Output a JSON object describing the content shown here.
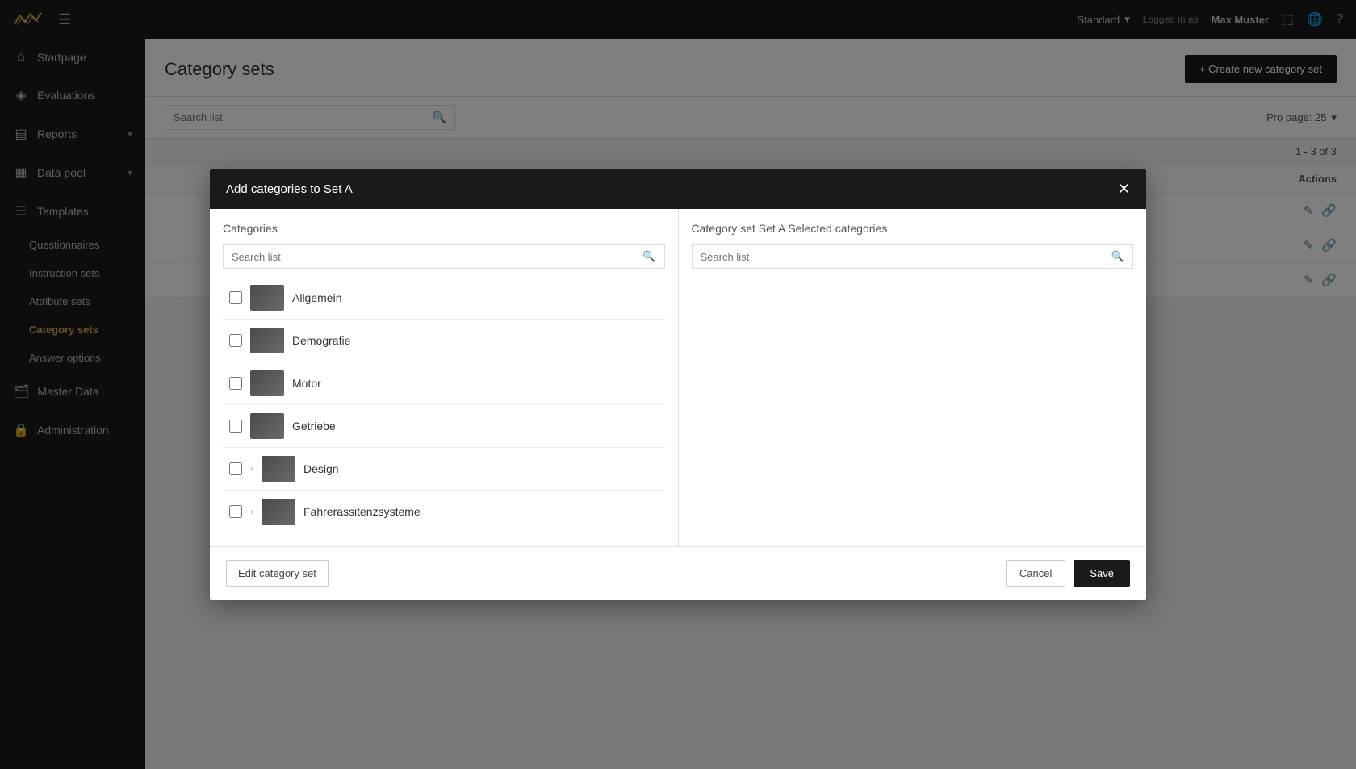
{
  "topbar": {
    "dropdown_label": "Standard",
    "logged_in_text": "Logged in as",
    "user_name": "Max Muster"
  },
  "sidebar": {
    "items": [
      {
        "id": "startpage",
        "label": "Startpage",
        "icon": "🏠"
      },
      {
        "id": "evaluations",
        "label": "Evaluations",
        "icon": "📊"
      },
      {
        "id": "reports",
        "label": "Reports",
        "icon": "📄",
        "has_chevron": true
      },
      {
        "id": "data-pool",
        "label": "Data pool",
        "icon": "🗄",
        "has_chevron": true
      },
      {
        "id": "templates",
        "label": "Templates",
        "icon": "📋"
      },
      {
        "id": "master-data",
        "label": "Master Data",
        "icon": "🗂"
      },
      {
        "id": "administration",
        "label": "Administration",
        "icon": "🔒"
      }
    ],
    "sub_items": [
      {
        "id": "questionnaires",
        "label": "Questionnaires"
      },
      {
        "id": "instruction-sets",
        "label": "Instruction sets"
      },
      {
        "id": "attribute-sets",
        "label": "Attribute sets"
      },
      {
        "id": "category-sets",
        "label": "Category sets",
        "active": true
      },
      {
        "id": "answer-options",
        "label": "Answer options"
      }
    ]
  },
  "page": {
    "title": "Category sets",
    "create_button_label": "+ Create new category set",
    "search_placeholder": "Search list",
    "per_page_label": "Pro page: 25",
    "pagination_info": "1 - 3 of 3",
    "actions_column": "Actions"
  },
  "table_rows": [
    {
      "id": 1
    },
    {
      "id": 2
    },
    {
      "id": 3
    }
  ],
  "modal": {
    "title": "Add categories to Set A",
    "left_section_title": "Categories",
    "right_section_title": "Category set Set A Selected categories",
    "left_search_placeholder": "Search list",
    "right_search_placeholder": "Search list",
    "categories": [
      {
        "id": 1,
        "name": "Allgemein",
        "has_chevron": false
      },
      {
        "id": 2,
        "name": "Demografie",
        "has_chevron": false
      },
      {
        "id": 3,
        "name": "Motor",
        "has_chevron": false
      },
      {
        "id": 4,
        "name": "Getriebe",
        "has_chevron": false
      },
      {
        "id": 5,
        "name": "Design",
        "has_chevron": true
      },
      {
        "id": 6,
        "name": "Fahrerassitenzsysteme",
        "has_chevron": true
      }
    ],
    "edit_button_label": "Edit category set",
    "cancel_button_label": "Cancel",
    "save_button_label": "Save"
  }
}
